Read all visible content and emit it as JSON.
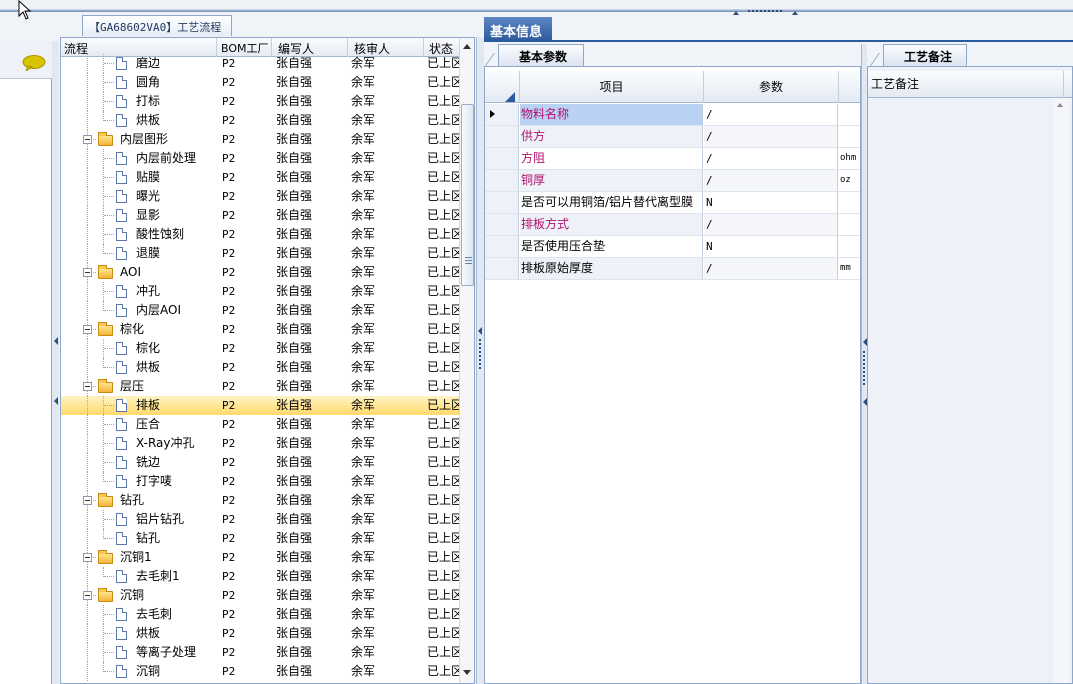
{
  "title_bar": {
    "document_tab": "【GA68602VA0】工艺流程"
  },
  "tree": {
    "columns": {
      "flow": "流程",
      "bom_factory": "BOM工厂",
      "writer": "编写人",
      "reviewer": "核审人",
      "status": "状态"
    },
    "rows": [
      {
        "label": "磨边",
        "type": "step",
        "bom": "P2",
        "writer": "张自强",
        "reviewer": "余军",
        "status": "已上区"
      },
      {
        "label": "圆角",
        "type": "step",
        "bom": "P2",
        "writer": "张自强",
        "reviewer": "余军",
        "status": "已上区"
      },
      {
        "label": "打标",
        "type": "step",
        "bom": "P2",
        "writer": "张自强",
        "reviewer": "余军",
        "status": "已上区"
      },
      {
        "label": "烘板",
        "type": "step",
        "bom": "P2",
        "writer": "张自强",
        "reviewer": "余军",
        "status": "已上区"
      },
      {
        "label": "内层图形",
        "type": "group",
        "bom": "P2",
        "writer": "张自强",
        "reviewer": "余军",
        "status": "已上区"
      },
      {
        "label": "内层前处理",
        "type": "step",
        "bom": "P2",
        "writer": "张自强",
        "reviewer": "余军",
        "status": "已上区"
      },
      {
        "label": "贴膜",
        "type": "step",
        "bom": "P2",
        "writer": "张自强",
        "reviewer": "余军",
        "status": "已上区"
      },
      {
        "label": "曝光",
        "type": "step",
        "bom": "P2",
        "writer": "张自强",
        "reviewer": "余军",
        "status": "已上区"
      },
      {
        "label": "显影",
        "type": "step",
        "bom": "P2",
        "writer": "张自强",
        "reviewer": "余军",
        "status": "已上区"
      },
      {
        "label": "酸性蚀刻",
        "type": "step",
        "bom": "P2",
        "writer": "张自强",
        "reviewer": "余军",
        "status": "已上区"
      },
      {
        "label": "退膜",
        "type": "step",
        "bom": "P2",
        "writer": "张自强",
        "reviewer": "余军",
        "status": "已上区"
      },
      {
        "label": "AOI",
        "type": "group",
        "bom": "P2",
        "writer": "张自强",
        "reviewer": "余军",
        "status": "已上区"
      },
      {
        "label": "冲孔",
        "type": "step",
        "bom": "P2",
        "writer": "张自强",
        "reviewer": "余军",
        "status": "已上区"
      },
      {
        "label": "内层AOI",
        "type": "step",
        "bom": "P2",
        "writer": "张自强",
        "reviewer": "余军",
        "status": "已上区"
      },
      {
        "label": "棕化",
        "type": "group",
        "bom": "P2",
        "writer": "张自强",
        "reviewer": "余军",
        "status": "已上区"
      },
      {
        "label": "棕化",
        "type": "step",
        "bom": "P2",
        "writer": "张自强",
        "reviewer": "余军",
        "status": "已上区"
      },
      {
        "label": "烘板",
        "type": "step",
        "bom": "P2",
        "writer": "张自强",
        "reviewer": "余军",
        "status": "已上区"
      },
      {
        "label": "层压",
        "type": "group",
        "bom": "P2",
        "writer": "张自强",
        "reviewer": "余军",
        "status": "已上区"
      },
      {
        "label": "排板",
        "type": "step",
        "selected": true,
        "bom": "P2",
        "writer": "张自强",
        "reviewer": "余军",
        "status": "已上区"
      },
      {
        "label": "压合",
        "type": "step",
        "bom": "P2",
        "writer": "张自强",
        "reviewer": "余军",
        "status": "已上区"
      },
      {
        "label": "X-Ray冲孔",
        "type": "step",
        "bom": "P2",
        "writer": "张自强",
        "reviewer": "余军",
        "status": "已上区"
      },
      {
        "label": "铣边",
        "type": "step",
        "bom": "P2",
        "writer": "张自强",
        "reviewer": "余军",
        "status": "已上区"
      },
      {
        "label": "打字唛",
        "type": "step",
        "bom": "P2",
        "writer": "张自强",
        "reviewer": "余军",
        "status": "已上区"
      },
      {
        "label": "钻孔",
        "type": "group",
        "bom": "P2",
        "writer": "张自强",
        "reviewer": "余军",
        "status": "已上区"
      },
      {
        "label": "铝片钻孔",
        "type": "step",
        "bom": "P2",
        "writer": "张自强",
        "reviewer": "余军",
        "status": "已上区"
      },
      {
        "label": "钻孔",
        "type": "step",
        "bom": "P2",
        "writer": "张自强",
        "reviewer": "余军",
        "status": "已上区"
      },
      {
        "label": "沉铜1",
        "type": "group",
        "bom": "P2",
        "writer": "张自强",
        "reviewer": "余军",
        "status": "已上区"
      },
      {
        "label": "去毛刺1",
        "type": "step",
        "bom": "P2",
        "writer": "张自强",
        "reviewer": "余军",
        "status": "已上区"
      },
      {
        "label": "沉铜",
        "type": "group",
        "bom": "P2",
        "writer": "张自强",
        "reviewer": "余军",
        "status": "已上区"
      },
      {
        "label": "去毛刺",
        "type": "step",
        "bom": "P2",
        "writer": "张自强",
        "reviewer": "余军",
        "status": "已上区"
      },
      {
        "label": "烘板",
        "type": "step",
        "bom": "P2",
        "writer": "张自强",
        "reviewer": "余军",
        "status": "已上区"
      },
      {
        "label": "等离子处理",
        "type": "step",
        "bom": "P2",
        "writer": "张自强",
        "reviewer": "余军",
        "status": "已上区"
      },
      {
        "label": "沉铜",
        "type": "step",
        "bom": "P2",
        "writer": "张自强",
        "reviewer": "余军",
        "status": "已上区"
      }
    ]
  },
  "basic_info": {
    "main_tab": "基本信息",
    "sub_tab": "基本参数",
    "columns": {
      "item": "项目",
      "param": "参数"
    },
    "rows": [
      {
        "label": "物料名称",
        "value": "/",
        "unit": "",
        "pink": true,
        "active": true
      },
      {
        "label": "供方",
        "value": "/",
        "unit": "",
        "pink": true
      },
      {
        "label": "方阻",
        "value": "/",
        "unit": "ohm",
        "pink": true
      },
      {
        "label": "铜厚",
        "value": "/",
        "unit": "oz",
        "pink": true
      },
      {
        "label": "是否可以用铜箔/铝片替代离型膜",
        "value": "N",
        "unit": ""
      },
      {
        "label": "排板方式",
        "value": "/",
        "unit": "",
        "pink": true
      },
      {
        "label": "是否使用压合垫",
        "value": "N",
        "unit": ""
      },
      {
        "label": "排板原始厚度",
        "value": "/",
        "unit": "mm"
      }
    ]
  },
  "craft_notes": {
    "tab": "工艺备注",
    "column": "工艺备注"
  },
  "colors": {
    "selected_row": "#ffd96b",
    "main_tab": "#2c5a9e",
    "pink_label": "#b0126e",
    "active_cell": "#b9d1f2"
  }
}
